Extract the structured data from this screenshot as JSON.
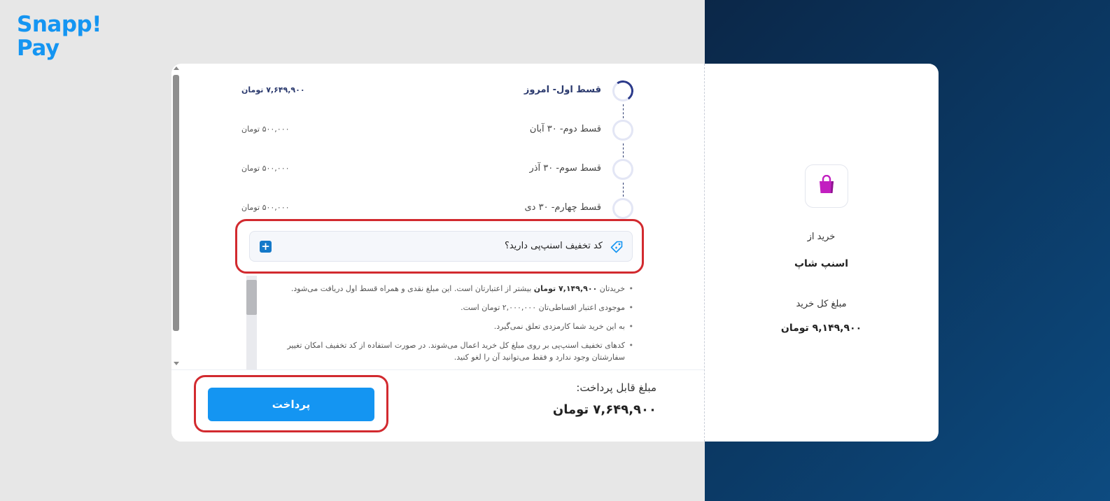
{
  "logo": {
    "line1": "Snapp!",
    "line2": "Pay"
  },
  "installments": [
    {
      "title": "قسط اول- امروز",
      "amount": "۷,۶۴۹,۹۰۰ تومان",
      "active": true
    },
    {
      "title": "قسط دوم- ۳۰ آبان",
      "amount": "۵۰۰,۰۰۰ تومان",
      "active": false
    },
    {
      "title": "قسط سوم- ۳۰ آذر",
      "amount": "۵۰۰,۰۰۰ تومان",
      "active": false
    },
    {
      "title": "قسط چهارم- ۳۰ دی",
      "amount": "۵۰۰,۰۰۰ تومان",
      "active": false
    }
  ],
  "discount": {
    "label": "کد تخفیف اسنپ‌پی دارید؟",
    "icon": "tag-icon",
    "add_icon": "plus-icon"
  },
  "notes": {
    "n1_pre": "خریدتان",
    "n1_bold": "۷,۱۴۹,۹۰۰ تومان",
    "n1_post": "بیشتر از اعتبارتان است. این مبلغ نقدی و همراه قسط اول دریافت می‌شود.",
    "n2": "موجودی اعتبار اقساطی‌تان ۲,۰۰۰,۰۰۰ تومان است.",
    "n3": "به این خرید شما کارمزدی تعلق نمی‌گیرد.",
    "n4": "کدهای تخفیف اسنپ‌پی بر روی مبلغ کل خرید اعمال می‌شوند. در صورت استفاده از کد تخفیف امکان تغییر سفارشتان وجود ندارد و فقط می‌توانید آن را لغو کنید."
  },
  "footer": {
    "payable_label": "مبلغ قابل پرداخت:",
    "payable_value": "۷,۶۴۹,۹۰۰ تومان",
    "pay_button": "پرداخت"
  },
  "summary": {
    "from_label": "خرید از",
    "shop_name": "اسنپ شاپ",
    "total_label": "مبلغ کل خرید",
    "total_value": "۹,۱۴۹,۹۰۰ تومان",
    "shop_icon": "shopping-bag-icon"
  },
  "colors": {
    "brand": "#1495f2",
    "highlight": "#d22a2f",
    "dark_bg": "#0b2748",
    "accent_text": "#2b3a6e",
    "bag": "#c21fc0"
  }
}
